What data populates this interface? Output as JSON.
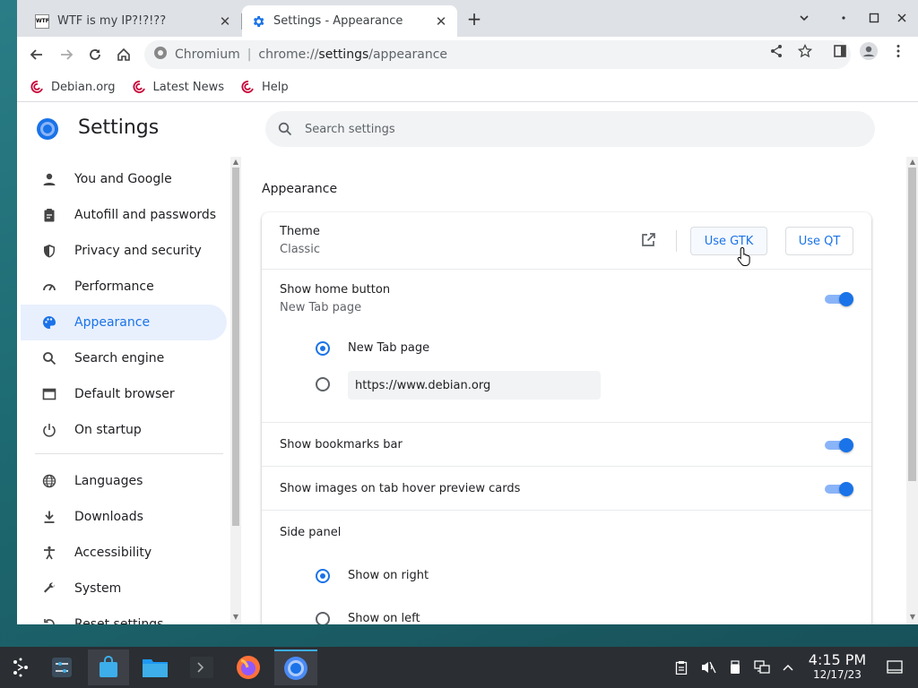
{
  "tabs": [
    {
      "title": "WTF is my IP?!?!??",
      "favicon": "wtf-favicon",
      "active": false
    },
    {
      "title": "Settings - Appearance",
      "favicon": "gear-icon",
      "active": true
    }
  ],
  "toolbar": {
    "site": "Chromium",
    "url_scheme": "chrome://",
    "url_host": "settings",
    "url_path": "/appearance"
  },
  "bookmarks": [
    {
      "label": "Debian.org"
    },
    {
      "label": "Latest News"
    },
    {
      "label": "Help"
    }
  ],
  "settings": {
    "title": "Settings",
    "search_placeholder": "Search settings"
  },
  "sidebar": {
    "items": [
      {
        "label": "You and Google",
        "icon": "person-icon"
      },
      {
        "label": "Autofill and passwords",
        "icon": "clipboard-icon"
      },
      {
        "label": "Privacy and security",
        "icon": "shield-icon"
      },
      {
        "label": "Performance",
        "icon": "speedometer-icon"
      },
      {
        "label": "Appearance",
        "icon": "palette-icon",
        "active": true
      },
      {
        "label": "Search engine",
        "icon": "search-icon"
      },
      {
        "label": "Default browser",
        "icon": "browser-icon"
      },
      {
        "label": "On startup",
        "icon": "power-icon"
      },
      {
        "label": "Languages",
        "icon": "globe-icon"
      },
      {
        "label": "Downloads",
        "icon": "download-icon"
      },
      {
        "label": "Accessibility",
        "icon": "accessibility-icon"
      },
      {
        "label": "System",
        "icon": "wrench-icon"
      },
      {
        "label": "Reset settings",
        "icon": "reset-icon"
      }
    ]
  },
  "appearance": {
    "section_title": "Appearance",
    "theme": {
      "label": "Theme",
      "value": "Classic",
      "gtk_button": "Use GTK",
      "qt_button": "Use QT"
    },
    "home_button": {
      "label": "Show home button",
      "value": "New Tab page",
      "enabled": true,
      "options": [
        {
          "label": "New Tab page",
          "selected": true
        },
        {
          "label": "https://www.debian.org",
          "selected": false
        }
      ]
    },
    "bookmarks_bar": {
      "label": "Show bookmarks bar",
      "enabled": true
    },
    "hover_cards": {
      "label": "Show images on tab hover preview cards",
      "enabled": true
    },
    "side_panel": {
      "label": "Side panel",
      "options": [
        {
          "label": "Show on right",
          "selected": true
        },
        {
          "label": "Show on left",
          "selected": false
        }
      ]
    }
  },
  "taskbar": {
    "time": "4:15 PM",
    "date": "12/17/23"
  },
  "colors": {
    "accent": "#1a73e8",
    "active_nav_bg": "#e8f0fe",
    "taskbar": "#2b2e33"
  }
}
